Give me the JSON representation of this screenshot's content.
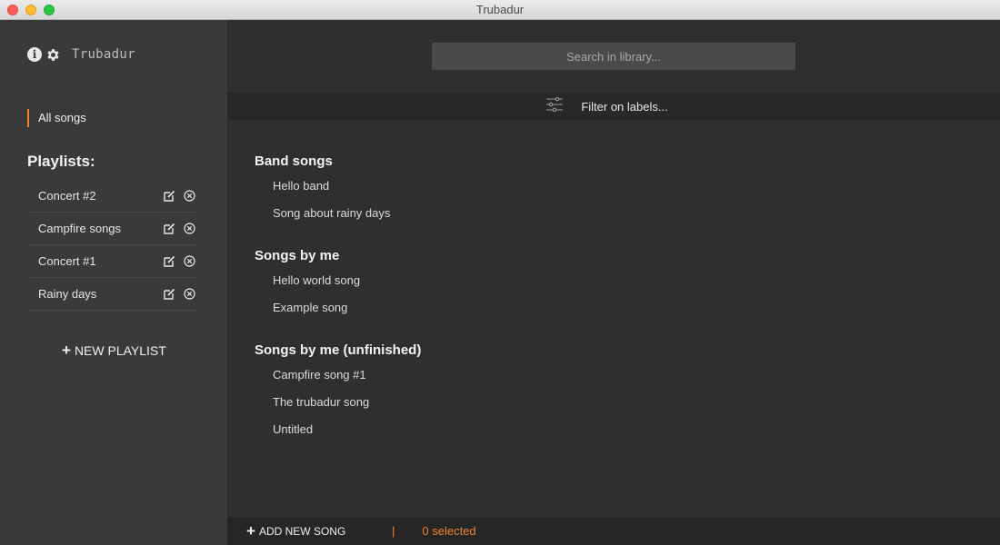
{
  "window": {
    "title": "Trubadur"
  },
  "sidebar": {
    "app_name": "Trubadur",
    "info_icon": "info-icon",
    "settings_icon": "gear-icon",
    "all_songs_label": "All songs",
    "playlists_heading": "Playlists:",
    "playlists": [
      {
        "label": "Concert #2"
      },
      {
        "label": "Campfire songs"
      },
      {
        "label": "Concert #1"
      },
      {
        "label": "Rainy days"
      }
    ],
    "new_playlist_label": "NEW PLAYLIST"
  },
  "main": {
    "search": {
      "placeholder": "Search in library...",
      "value": ""
    },
    "filter_label": "Filter on labels...",
    "groups": [
      {
        "title": "Band songs",
        "songs": [
          "Hello band",
          "Song about rainy days"
        ]
      },
      {
        "title": "Songs by me",
        "songs": [
          "Hello world song",
          "Example song"
        ]
      },
      {
        "title": "Songs by me (unfinished)",
        "songs": [
          "Campfire song #1",
          "The trubadur song",
          "Untitled"
        ]
      }
    ],
    "footer": {
      "add_song_label": "ADD NEW SONG",
      "separator": "|",
      "selected_text": "0 selected"
    }
  },
  "colors": {
    "accent": "#f0812f",
    "sidebar_bg": "#3a3a3a",
    "main_bg": "#2f2f2f"
  }
}
